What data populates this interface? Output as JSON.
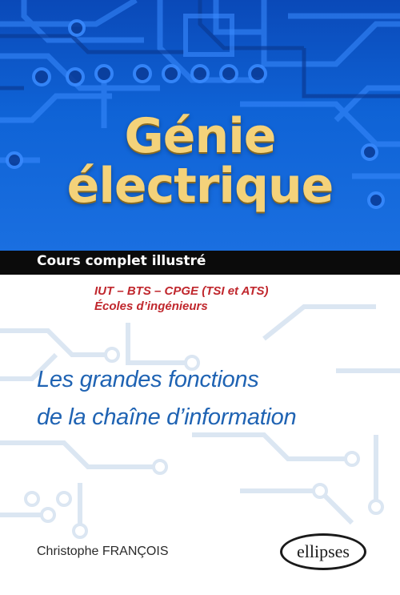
{
  "cover": {
    "title_line1": "Génie",
    "title_line2": "électrique",
    "band_text": "Cours complet illustré",
    "audience_line1": "IUT – BTS – CPGE (TSI et ATS)",
    "audience_line2": "Écoles d’ingénieurs",
    "subtitle_line1": "Les grandes fonctions",
    "subtitle_line2": "de la chaîne d’information",
    "author": "Christophe FRANÇOIS",
    "publisher_logo": "ellipses"
  },
  "colors": {
    "top_background": "#0f63d6",
    "title_gold": "#f4d27a",
    "band_black": "#0b0b0b",
    "audience_red": "#c0272d",
    "subtitle_blue": "#1f63b3"
  }
}
